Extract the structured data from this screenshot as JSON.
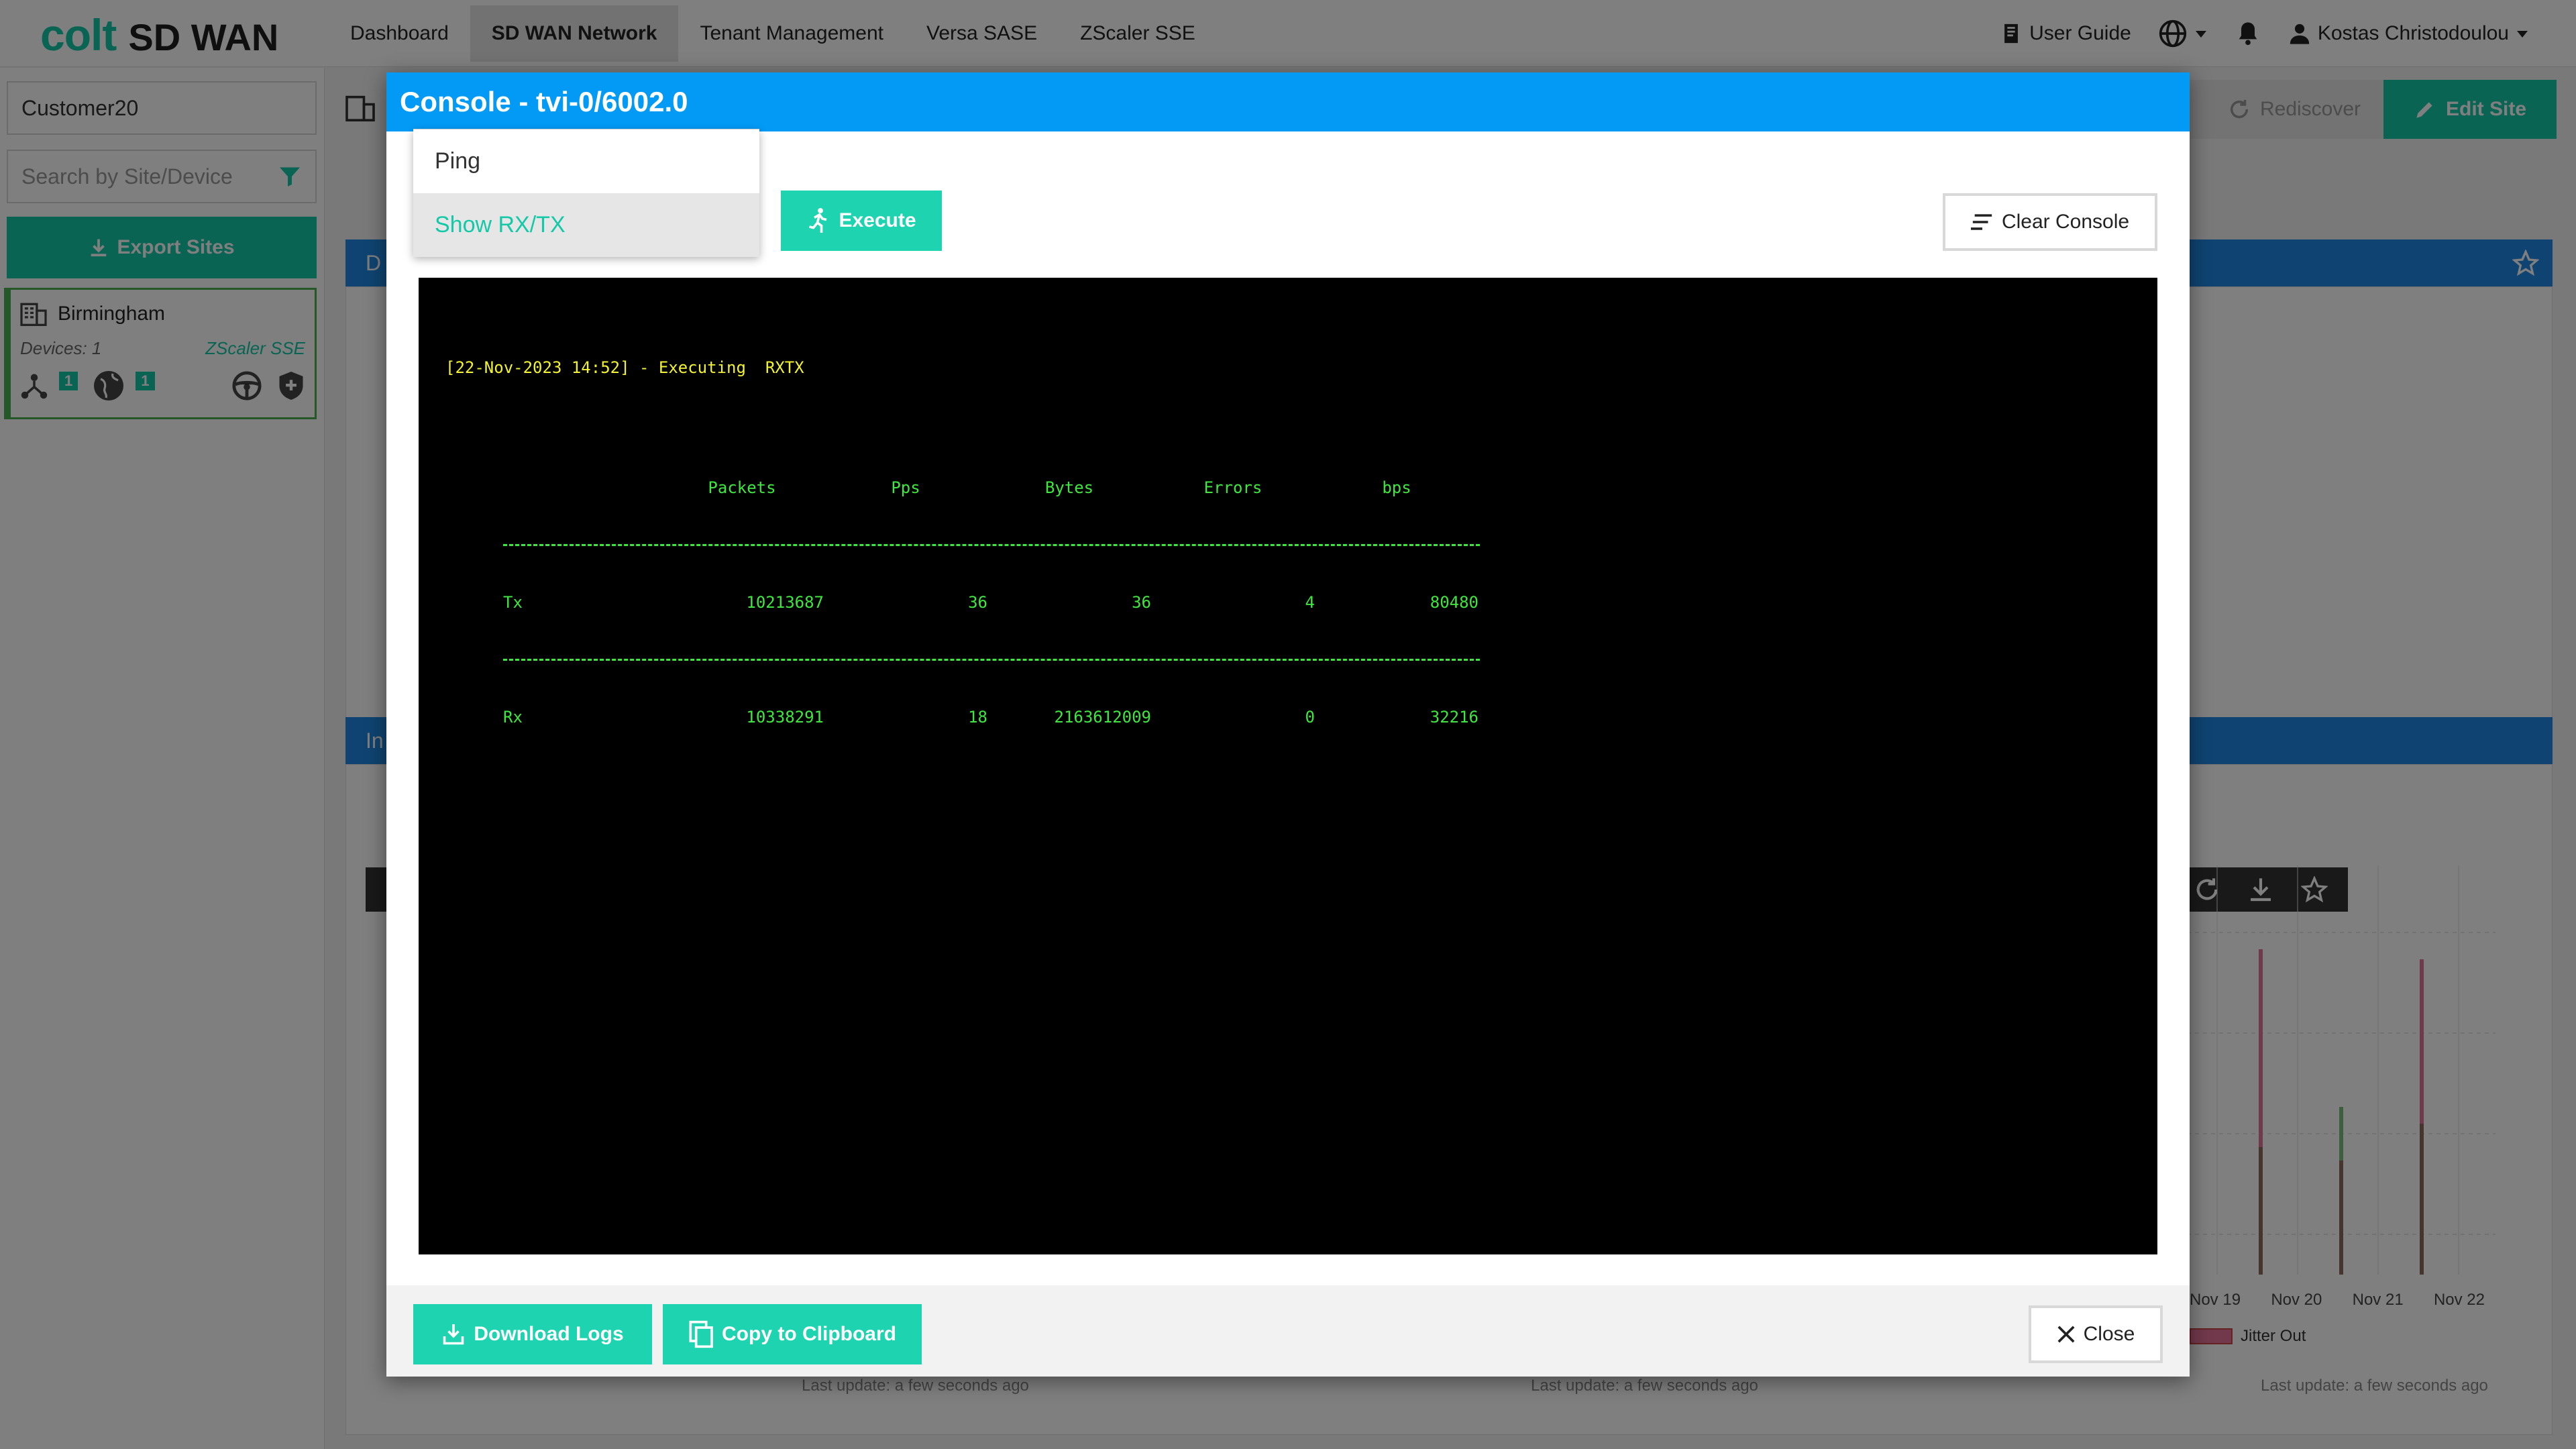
{
  "header": {
    "logo_brand": "colt",
    "logo_product": "SD WAN",
    "nav": [
      "Dashboard",
      "SD WAN Network",
      "Tenant Management",
      "Versa SASE",
      "ZScaler SSE"
    ],
    "user_guide": "User Guide",
    "user_name": "Kostas Christodoulou"
  },
  "sidebar": {
    "customer": "Customer20",
    "search_placeholder": "Search by Site/Device",
    "export_label": "Export Sites",
    "site": {
      "name": "Birmingham",
      "devices": "Devices: 1",
      "tag": "ZScaler SSE",
      "badge1": "1",
      "badge2": "1"
    }
  },
  "main": {
    "rediscover_label": "Rediscover",
    "edit_site_label": "Edit Site",
    "panel1_title": "D",
    "panel2_title": "In",
    "chart_xlabels": [
      "Nov 19",
      "Nov 20",
      "Nov 21",
      "Nov 22"
    ],
    "legend_label": "Jitter Out",
    "last_update": "Last update: a few seconds ago"
  },
  "modal": {
    "title": "Console - tvi-0/6002.0",
    "options": [
      "Ping",
      "Show RX/TX"
    ],
    "selected_option": "Show RX/TX",
    "execute_label": "Execute",
    "clear_label": "Clear Console",
    "console": {
      "exec_line": "[22-Nov-2023 14:52] - Executing  RXTX",
      "headers": [
        "Packets",
        "Pps",
        "Bytes",
        "Errors",
        "bps"
      ],
      "rows": [
        {
          "label": "Tx",
          "values": [
            "10213687",
            "36",
            "36",
            "4",
            "80480"
          ]
        },
        {
          "label": "Rx",
          "values": [
            "10338291",
            "18",
            "2163612009",
            "0",
            "32216"
          ]
        }
      ]
    },
    "download_label": "Download Logs",
    "copy_label": "Copy to Clipboard",
    "close_label": "Close"
  },
  "colors": {
    "brand": "#14c9a8",
    "modal_header": "#039af6",
    "panel_header": "#1e88e5",
    "console_text": "#3fe63f",
    "console_exec": "#f2f230"
  }
}
